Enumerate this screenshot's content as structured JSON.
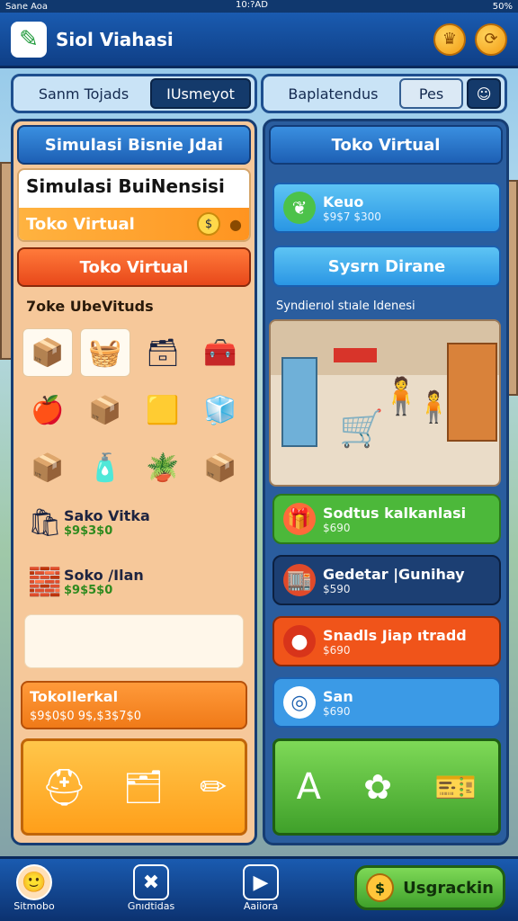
{
  "status": {
    "carrier": "Sane Aoa",
    "time": "10:?AD",
    "battery": "50%"
  },
  "header": {
    "title": "Siol Viahasi"
  },
  "tabs_left": {
    "first": "Sanm Tojads",
    "second": "IUsmeyot"
  },
  "tabs_right": {
    "first": "Baplatendus",
    "second": "Pes"
  },
  "left_panel": {
    "header": "Simulasi Bisnie Jdai",
    "business_title": "Simulasi BuiNensisi",
    "store_button": "Toko Virtual",
    "store_header": "Toko Virtual",
    "section_title": "7oke UbeVituds",
    "items": [
      {
        "icon": "box-icon"
      },
      {
        "icon": "crate-icon"
      },
      {
        "icon": "paper-box-icon"
      },
      {
        "icon": "red-box-icon"
      },
      {
        "icon": "fruit-basket-icon"
      },
      {
        "icon": "orange-box-icon"
      },
      {
        "icon": "yellow-box-icon"
      },
      {
        "icon": "teal-box-icon"
      },
      {
        "icon": "package-icon"
      },
      {
        "icon": "bottles-icon"
      },
      {
        "icon": "plant-box-icon"
      },
      {
        "icon": "shipping-box-icon"
      }
    ],
    "list": [
      {
        "name": "Sako Vitka",
        "price": "$9$3$0"
      },
      {
        "name": "Soko /Ilan",
        "price": "$9$5$0"
      }
    ],
    "summary": {
      "title": "TokoIlerkal",
      "value": "$9$0$0  9$,$3$7$0"
    }
  },
  "right_panel": {
    "header": "Toko Virtual",
    "featured": {
      "name": "Keuo",
      "price": "$9$7 $300"
    },
    "system_header": "Sysrn Dirane",
    "scene_label": "Syndierıol stıale Idenesi",
    "rows": [
      {
        "name": "Sodtus kalkanlasi",
        "price": "$690",
        "color": "#4cb83a"
      },
      {
        "name": "Gedetar |Gunihay",
        "price": "$590",
        "color": "#1c3f73"
      },
      {
        "name": "Snadls Jiap ıtradd",
        "price": "$690",
        "color": "#f0541a"
      },
      {
        "name": "San",
        "price": "$690",
        "color": "#3b9ae6"
      }
    ]
  },
  "bottom_nav": {
    "profile": "Sitmobo",
    "tools": "Gnıdtidas",
    "play": "Aaiiora",
    "upgrade": "Usgrackin"
  }
}
